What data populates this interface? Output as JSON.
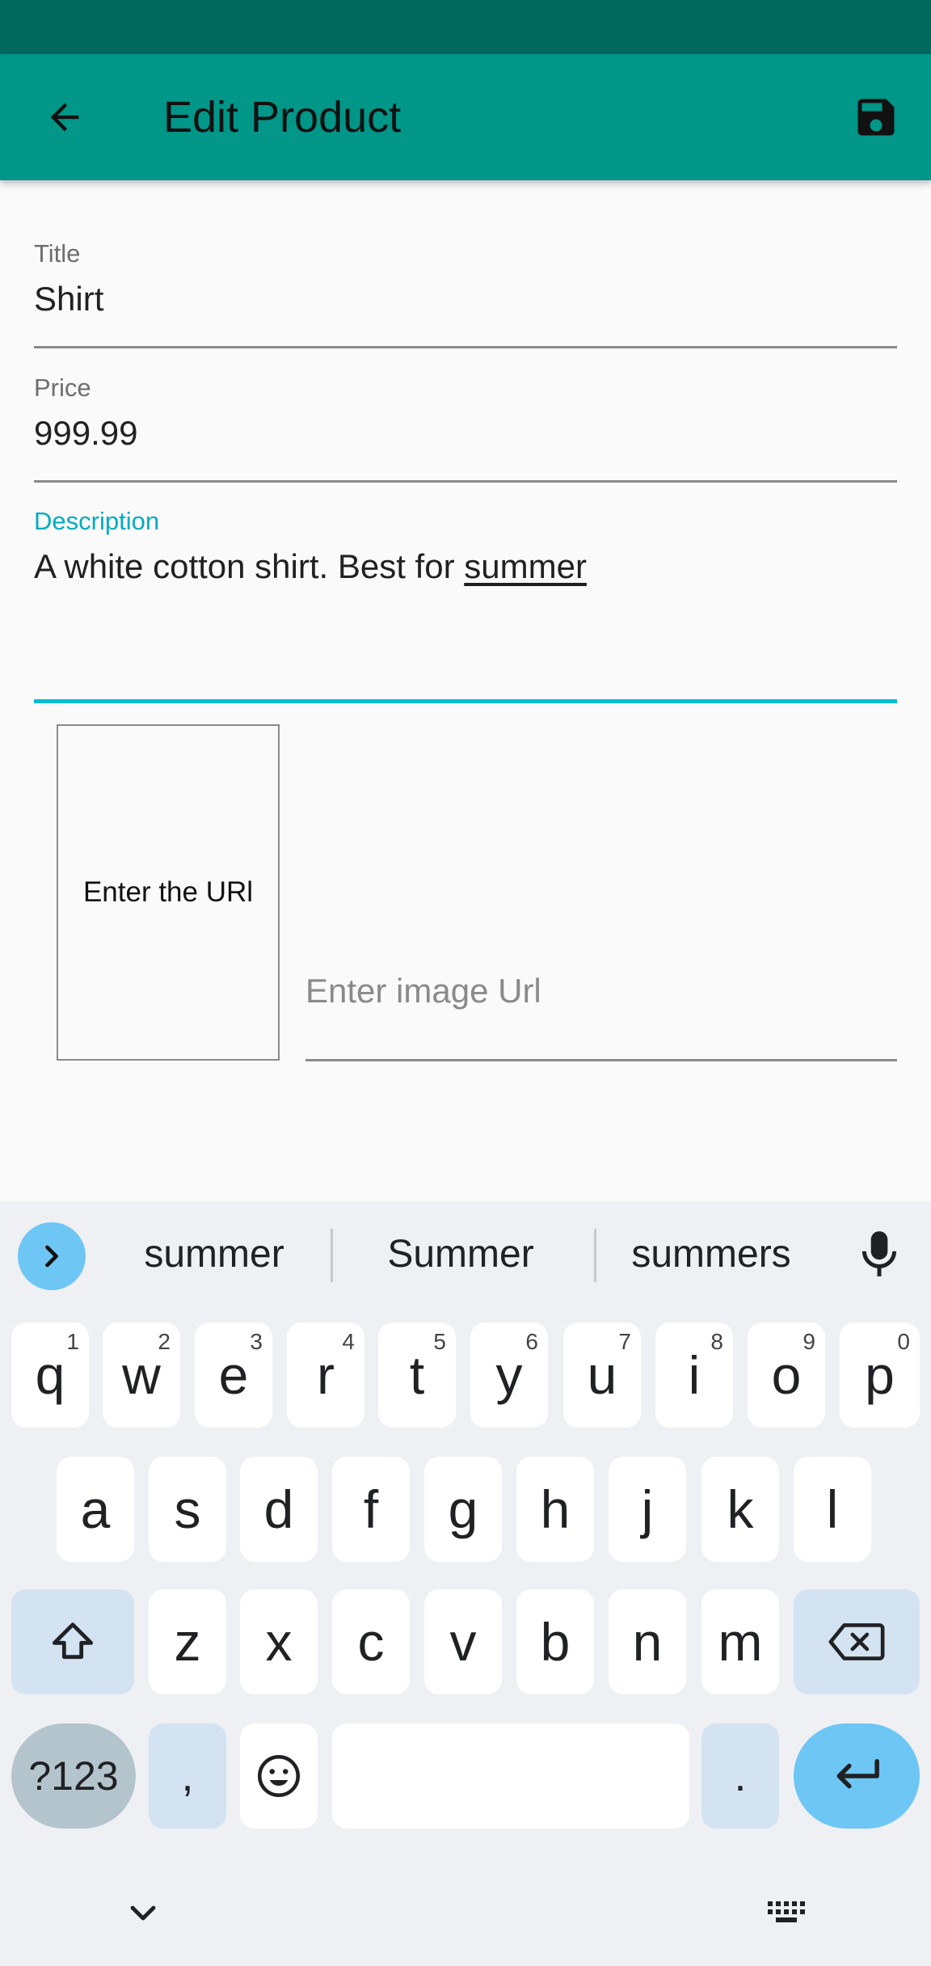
{
  "app_bar": {
    "title": "Edit Product"
  },
  "form": {
    "title_label": "Title",
    "title_value": "Shirt",
    "price_label": "Price",
    "price_value": "999.99",
    "description_label": "Description",
    "description_prefix": "A white cotton shirt. Best for ",
    "description_word": "summer",
    "image_preview_text": "Enter the URl",
    "image_url_placeholder": "Enter image Url"
  },
  "keyboard": {
    "suggestions": [
      "summer",
      "Summer",
      "summers"
    ],
    "row1": [
      {
        "key": "q",
        "hint": "1"
      },
      {
        "key": "w",
        "hint": "2"
      },
      {
        "key": "e",
        "hint": "3"
      },
      {
        "key": "r",
        "hint": "4"
      },
      {
        "key": "t",
        "hint": "5"
      },
      {
        "key": "y",
        "hint": "6"
      },
      {
        "key": "u",
        "hint": "7"
      },
      {
        "key": "i",
        "hint": "8"
      },
      {
        "key": "o",
        "hint": "9"
      },
      {
        "key": "p",
        "hint": "0"
      }
    ],
    "row2": [
      "a",
      "s",
      "d",
      "f",
      "g",
      "h",
      "j",
      "k",
      "l"
    ],
    "row3": [
      "z",
      "x",
      "c",
      "v",
      "b",
      "n",
      "m"
    ],
    "sym_label": "?123",
    "comma_label": ",",
    "period_label": "."
  },
  "colors": {
    "status_bar": "#00695c",
    "app_bar": "#009688",
    "accent": "#00bcd4",
    "suggest_button": "#6ec6f5"
  },
  "icons": {
    "back": "arrow-left-icon",
    "save": "floppy-disk-icon",
    "expand": "chevron-right-icon",
    "mic": "microphone-icon",
    "shift": "shift-icon",
    "backspace": "backspace-icon",
    "emoji": "emoji-icon",
    "enter": "enter-icon",
    "hide": "chevron-down-icon",
    "switch_keyboard": "keyboard-icon"
  }
}
